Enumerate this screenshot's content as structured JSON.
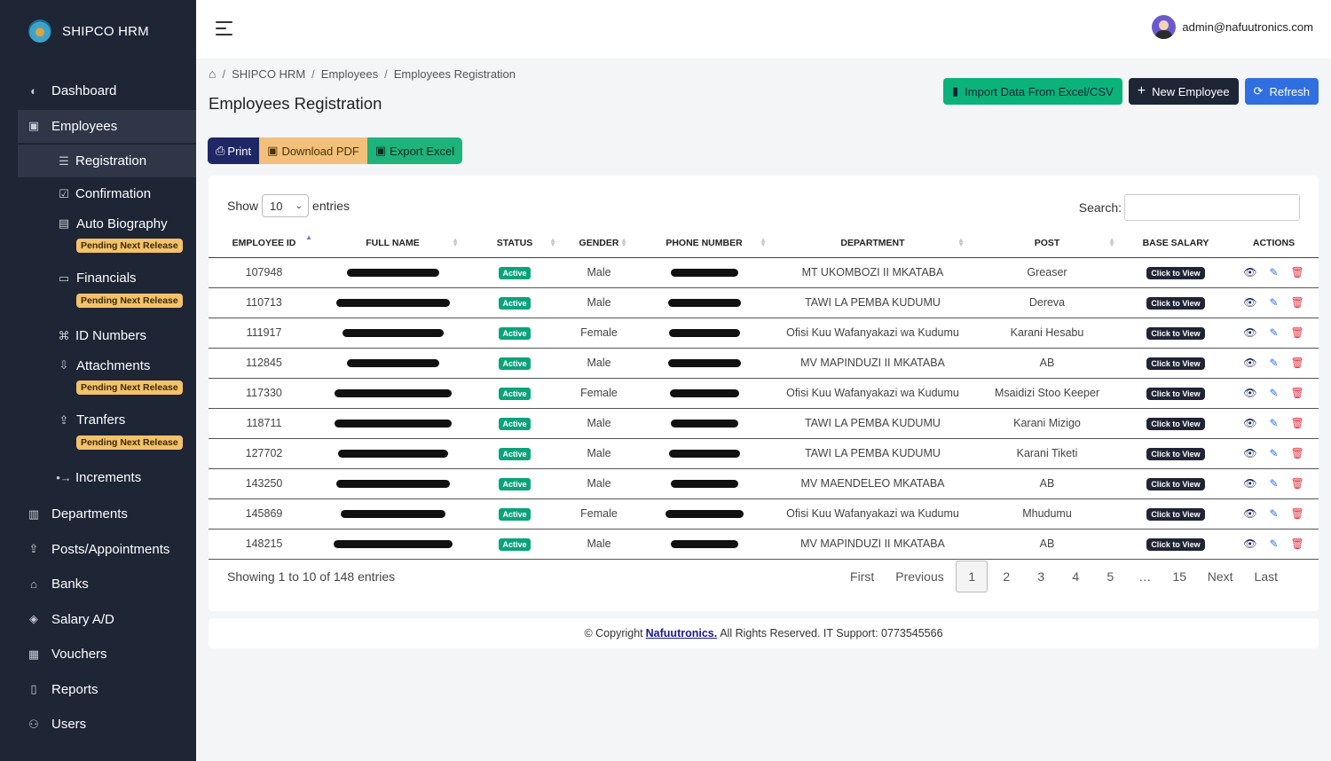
{
  "app": {
    "name": "SHIPCO HRM"
  },
  "sidebar": {
    "items": [
      {
        "label": "Dashboard",
        "icon": "palette-icon"
      },
      {
        "label": "Employees",
        "icon": "id-card-icon"
      },
      {
        "label": "Departments",
        "icon": "building-icon"
      },
      {
        "label": "Posts/Appointments",
        "icon": "person-upload-icon"
      },
      {
        "label": "Banks",
        "icon": "bank-icon"
      },
      {
        "label": "Salary A/D",
        "icon": "layers-icon"
      },
      {
        "label": "Vouchers",
        "icon": "receipt-icon"
      },
      {
        "label": "Reports",
        "icon": "file-icon"
      },
      {
        "label": "Users",
        "icon": "users-icon"
      }
    ],
    "employees_sub": {
      "registration": "Registration",
      "confirmation": "Confirmation",
      "auto_biography": "Auto Biography",
      "financials": "Financials",
      "id_numbers": "ID Numbers",
      "attachments": "Attachments",
      "tranfers": "Tranfers",
      "increments": "Increments",
      "pending": "Pending Next Release"
    }
  },
  "topbar": {
    "user_email": "admin@nafuutronics.com"
  },
  "breadcrumb": [
    "SHIPCO HRM",
    "Employees",
    "Employees Registration"
  ],
  "page_title": "Employees Registration",
  "buttons": {
    "import": "Import Data From Excel/CSV",
    "new_employee": "New Employee",
    "refresh": "Refresh"
  },
  "export": {
    "print": "Print",
    "pdf": "Download PDF",
    "excel": "Export Excel"
  },
  "table_controls": {
    "show": "Show",
    "entries_value": "10",
    "entries": "entries",
    "search_label": "Search:"
  },
  "table": {
    "headers": [
      "EMPLOYEE ID",
      "FULL NAME",
      "STATUS",
      "GENDER",
      "PHONE NUMBER",
      "DEPARTMENT",
      "POST",
      "BASE SALARY",
      "ACTIONS"
    ],
    "status_label": "Active",
    "salary_label": "Click to View",
    "rows": [
      {
        "id": "107948",
        "gender": "Male",
        "department": "MT UKOMBOZI II MKATABA",
        "post": "Greaser"
      },
      {
        "id": "110713",
        "gender": "Male",
        "department": "TAWI LA PEMBA KUDUMU",
        "post": "Dereva"
      },
      {
        "id": "111917",
        "gender": "Female",
        "department": "Ofisi Kuu Wafanyakazi wa Kudumu",
        "post": "Karani Hesabu"
      },
      {
        "id": "112845",
        "gender": "Male",
        "department": "MV MAPINDUZI II MKATABA",
        "post": "AB"
      },
      {
        "id": "117330",
        "gender": "Female",
        "department": "Ofisi Kuu Wafanyakazi wa Kudumu",
        "post": "Msaidizi Stoo Keeper"
      },
      {
        "id": "118711",
        "gender": "Male",
        "department": "TAWI LA PEMBA KUDUMU",
        "post": "Karani Mizigo"
      },
      {
        "id": "127702",
        "gender": "Male",
        "department": "TAWI LA PEMBA KUDUMU",
        "post": "Karani Tiketi"
      },
      {
        "id": "143250",
        "gender": "Male",
        "department": "MV MAENDELEO MKATABA",
        "post": "AB"
      },
      {
        "id": "145869",
        "gender": "Female",
        "department": "Ofisi Kuu Wafanyakazi wa Kudumu",
        "post": "Mhudumu"
      },
      {
        "id": "148215",
        "gender": "Male",
        "department": "MV MAPINDUZI II MKATABA",
        "post": "AB"
      }
    ]
  },
  "pagination": {
    "info": "Showing 1 to 10 of 148 entries",
    "first": "First",
    "previous": "Previous",
    "pages": [
      "1",
      "2",
      "3",
      "4",
      "5",
      "…",
      "15"
    ],
    "next": "Next",
    "last": "Last"
  },
  "footer": {
    "prefix": "© Copyright",
    "company": "Nafuutronics.",
    "suffix": "All Rights Reserved. IT Support: 0773545566"
  },
  "colors": {
    "sidebar": "#1e2535",
    "accent_green": "#0bb37a",
    "accent_blue": "#2f6fe0"
  }
}
